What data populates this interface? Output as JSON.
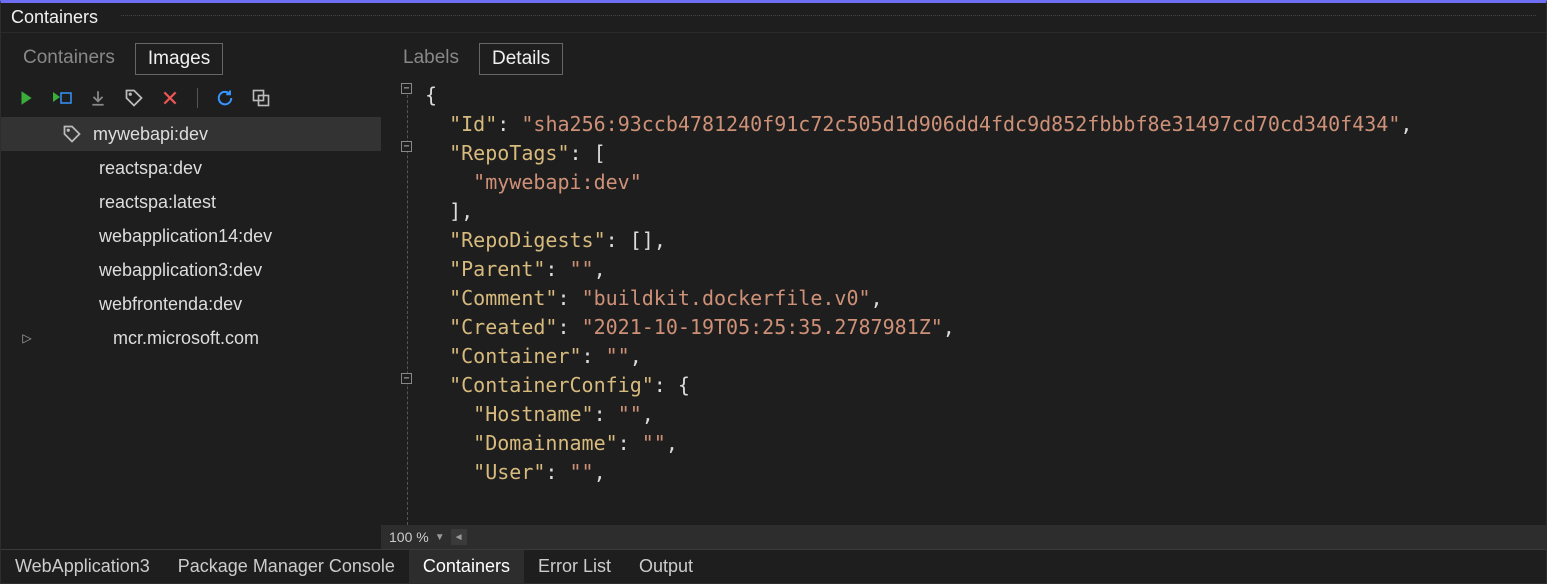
{
  "panel_title": "Containers",
  "left_tabs": [
    "Containers",
    "Images"
  ],
  "left_tab_active": 1,
  "toolbar_icons": [
    "run-icon",
    "run-new-icon",
    "download-icon",
    "tag-icon",
    "delete-icon",
    "refresh-icon",
    "prune-icon"
  ],
  "images": [
    {
      "name": "mywebapi:dev",
      "selected": true,
      "icon": true
    },
    {
      "name": "reactspa:dev"
    },
    {
      "name": "reactspa:latest"
    },
    {
      "name": "webapplication14:dev"
    },
    {
      "name": "webapplication3:dev"
    },
    {
      "name": "webfrontenda:dev"
    }
  ],
  "image_group": {
    "name": "mcr.microsoft.com",
    "expandable": true
  },
  "right_tabs": [
    "Labels",
    "Details"
  ],
  "right_tab_active": 1,
  "json_lines": [
    {
      "indent": 0,
      "fold": "-",
      "raw": "{"
    },
    {
      "indent": 1,
      "key": "Id",
      "val": "sha256:93ccb4781240f91c72c505d1d906dd4fdc9d852fbbbf8e31497cd70cd340f434",
      "comma": true
    },
    {
      "indent": 1,
      "fold": "-",
      "key": "RepoTags",
      "open": "["
    },
    {
      "indent": 2,
      "val": "mywebapi:dev"
    },
    {
      "indent": 1,
      "close": "]",
      "comma": true
    },
    {
      "indent": 1,
      "key": "RepoDigests",
      "inline": "[]",
      "comma": true
    },
    {
      "indent": 1,
      "key": "Parent",
      "val": "",
      "comma": true
    },
    {
      "indent": 1,
      "key": "Comment",
      "val": "buildkit.dockerfile.v0",
      "comma": true
    },
    {
      "indent": 1,
      "key": "Created",
      "val": "2021-10-19T05:25:35.2787981Z",
      "comma": true
    },
    {
      "indent": 1,
      "key": "Container",
      "val": "",
      "comma": true
    },
    {
      "indent": 1,
      "fold": "-",
      "key": "ContainerConfig",
      "open": "{"
    },
    {
      "indent": 2,
      "key": "Hostname",
      "val": "",
      "comma": true
    },
    {
      "indent": 2,
      "key": "Domainname",
      "val": "",
      "comma": true
    },
    {
      "indent": 2,
      "key": "User",
      "val": "",
      "comma": true
    }
  ],
  "zoom": "100 %",
  "bottom_tabs": [
    "WebApplication3",
    "Package Manager Console",
    "Containers",
    "Error List",
    "Output"
  ],
  "bottom_tab_active": 2
}
